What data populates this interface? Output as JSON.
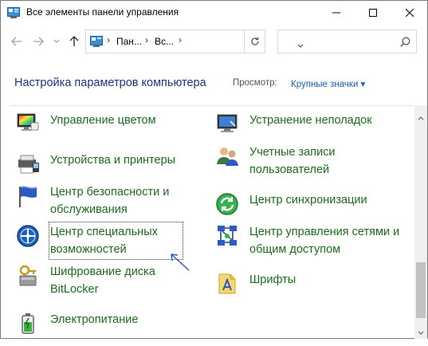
{
  "window": {
    "title": "Все элементы панели управления"
  },
  "address": {
    "crumbs": [
      "Пан...",
      "Вс..."
    ],
    "separator": "›"
  },
  "search": {
    "placeholder": ""
  },
  "header": {
    "title": "Настройка параметров компьютера",
    "view_label": "Просмотр:",
    "view_value": "Крупные значки ▾"
  },
  "items": [
    {
      "label": "Управление цветом",
      "icon": "color-management-icon"
    },
    {
      "label": "Устранение неполадок",
      "icon": "troubleshooting-icon"
    },
    {
      "label": "Устройства и принтеры",
      "icon": "devices-printers-icon"
    },
    {
      "label": "Учетные записи пользователей",
      "icon": "user-accounts-icon"
    },
    {
      "label": "Центр безопасности и обслуживания",
      "icon": "security-flag-icon"
    },
    {
      "label": "Центр синхронизации",
      "icon": "sync-center-icon"
    },
    {
      "label": "Центр специальных возможностей",
      "icon": "accessibility-icon"
    },
    {
      "label": "Центр управления сетями и общим доступом",
      "icon": "network-center-icon"
    },
    {
      "label": "Шифрование диска BitLocker",
      "icon": "bitlocker-icon"
    },
    {
      "label": "Шрифты",
      "icon": "fonts-icon"
    },
    {
      "label": "Электропитание",
      "icon": "power-options-icon"
    }
  ],
  "colors": {
    "link_green": "#1a6e1a",
    "heading_blue": "#1e3287",
    "accent_blue": "#1a5fb4"
  }
}
